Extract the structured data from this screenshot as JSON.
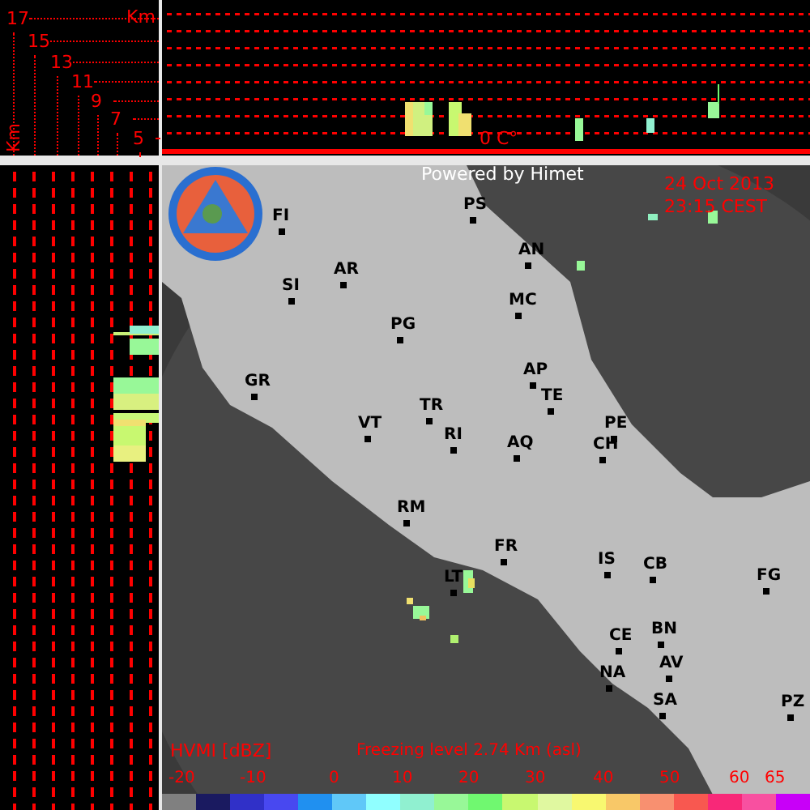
{
  "height_scale": {
    "unit": "Km",
    "unit_vertical": "Km",
    "ticks": [
      "17",
      "15",
      "13",
      "11",
      "9",
      "7",
      "5"
    ]
  },
  "top_profile": {
    "freezing_label": "0 C°"
  },
  "map": {
    "credit": "Powered by Himet",
    "date": "24 Oct 2013",
    "time": "23:15 CEST",
    "cities": [
      {
        "label": "FI"
      },
      {
        "label": "PS"
      },
      {
        "label": "AN"
      },
      {
        "label": "AR"
      },
      {
        "label": "SI"
      },
      {
        "label": "MC"
      },
      {
        "label": "PG"
      },
      {
        "label": "AP"
      },
      {
        "label": "GR"
      },
      {
        "label": "TE"
      },
      {
        "label": "TR"
      },
      {
        "label": "PE"
      },
      {
        "label": "VT"
      },
      {
        "label": "RI"
      },
      {
        "label": "AQ"
      },
      {
        "label": "CH"
      },
      {
        "label": "RM"
      },
      {
        "label": "FR"
      },
      {
        "label": "IS"
      },
      {
        "label": "CB"
      },
      {
        "label": "LT"
      },
      {
        "label": "FG"
      },
      {
        "label": "CE"
      },
      {
        "label": "BN"
      },
      {
        "label": "AV"
      },
      {
        "label": "NA"
      },
      {
        "label": "SA"
      },
      {
        "label": "PZ"
      }
    ]
  },
  "legend": {
    "title": "HVMI [dBZ]",
    "freezing_level": "Freezing level  2.74 Km (asl)",
    "ticks": [
      "-20",
      "-10",
      "0",
      "10",
      "20",
      "30",
      "40",
      "50",
      "60",
      "65"
    ],
    "swatches": [
      {
        "color": "#808080"
      },
      {
        "color": "#1a1a60"
      },
      {
        "color": "#3030c8"
      },
      {
        "color": "#4848f0"
      },
      {
        "color": "#2090f0"
      },
      {
        "color": "#60c8f8"
      },
      {
        "color": "#90ffff"
      },
      {
        "color": "#90f0d0"
      },
      {
        "color": "#98f898"
      },
      {
        "color": "#70f870"
      },
      {
        "color": "#c8f870"
      },
      {
        "color": "#e0f8a0"
      },
      {
        "color": "#f8f870"
      },
      {
        "color": "#f8c868"
      },
      {
        "color": "#f89070"
      },
      {
        "color": "#f85850"
      },
      {
        "color": "#f82878"
      },
      {
        "color": "#f850a0"
      },
      {
        "color": "#c800f8"
      }
    ]
  }
}
